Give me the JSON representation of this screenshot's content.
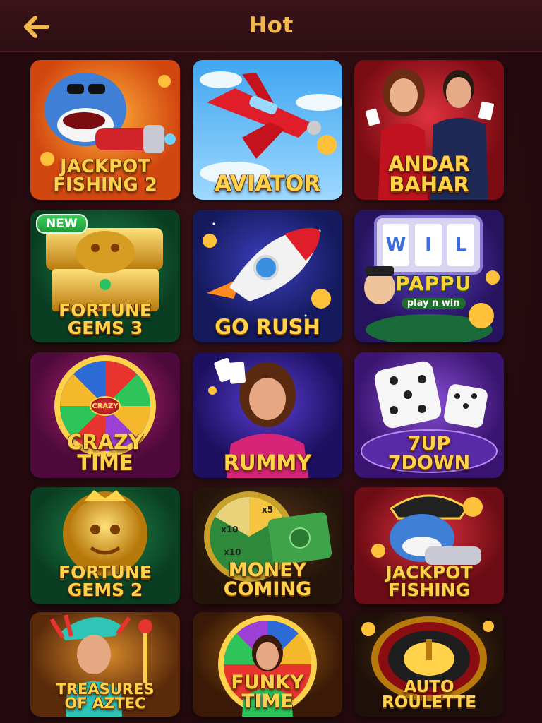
{
  "header": {
    "title": "Hot",
    "back_icon": "arrow-left-icon"
  },
  "colors": {
    "background": "#2a0d12",
    "accent": "#f2b84b"
  },
  "games": [
    {
      "label_lines": [
        "JACKPOT",
        "FISHING 2"
      ],
      "badge": ""
    },
    {
      "label_lines": [
        "AVIATOR"
      ],
      "badge": ""
    },
    {
      "label_lines": [
        "ANDAR",
        "BAHAR"
      ],
      "badge": ""
    },
    {
      "label_lines": [
        "FORTUNE",
        "GEMS 3"
      ],
      "badge": "NEW"
    },
    {
      "label_lines": [
        "GO RUSH"
      ],
      "badge": ""
    },
    {
      "label_lines": [
        "PAPPU"
      ],
      "badge": "",
      "sublabel": "play n win",
      "reel_letters": [
        "W",
        "I",
        "L"
      ]
    },
    {
      "label_lines": [
        "CRAZY",
        "TIME"
      ],
      "badge": "",
      "wheel_label": "CRAZY"
    },
    {
      "label_lines": [
        "RUMMY"
      ],
      "badge": ""
    },
    {
      "label_lines": [
        "7UP",
        "7DOWN"
      ],
      "badge": ""
    },
    {
      "label_lines": [
        "FORTUNE",
        "GEMS 2"
      ],
      "badge": ""
    },
    {
      "label_lines": [
        "MONEY",
        "COMING"
      ],
      "badge": "",
      "wheel_labels": [
        "x5",
        "x10",
        "x10"
      ]
    },
    {
      "label_lines": [
        "JACKPOT",
        "FISHING"
      ],
      "badge": ""
    },
    {
      "label_lines": [
        "TREASURES",
        "OF AZTEC"
      ],
      "badge": ""
    },
    {
      "label_lines": [
        "FUNKY",
        "TIME"
      ],
      "badge": ""
    },
    {
      "label_lines": [
        "AUTO",
        "ROULETTE"
      ],
      "badge": ""
    }
  ]
}
